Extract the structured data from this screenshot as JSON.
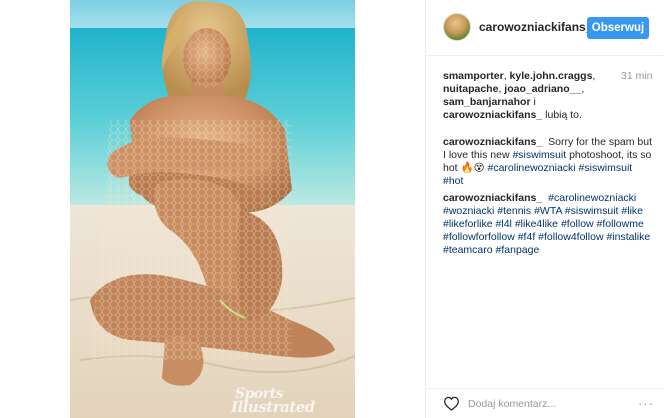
{
  "post": {
    "author": "carowozniackifans_",
    "follow_label": "Obserwuj",
    "time_ago": "31 min",
    "likes": {
      "users": [
        "smamporter",
        "kyle.john.craggs",
        "nuitapache",
        "joao_adriano__",
        "sam_banjarnahor"
      ],
      "and_label": "i",
      "last_user": "carowozniackifans_",
      "suffix": "lubią to."
    },
    "comments": [
      {
        "user": "carowozniackifans_",
        "text": "Sorry for the spam but I love this new",
        "tags_inline": [
          "#siswimsuit"
        ],
        "text2": "photoshoot, its so hot",
        "emoji": "🔥😵",
        "tags": [
          "#carolinewozniacki",
          "#siswimsuit",
          "#hot"
        ]
      },
      {
        "user": "carowozniackifans_",
        "tags": [
          "#carolinewozniacki",
          "#wozniacki",
          "#tennis",
          "#WTA",
          "#siswimsuit",
          "#like",
          "#likeforlike",
          "#l4l",
          "#like4like",
          "#follow",
          "#followme",
          "#followforfollow",
          "#f4f",
          "#follow4follow",
          "#instalike",
          "#teamcaro",
          "#fanpage"
        ]
      }
    ],
    "comment_placeholder": "Dodaj komentarz...",
    "more_label": "···",
    "watermark": {
      "line1": "Sports",
      "line2": "Illustrated"
    }
  },
  "colors": {
    "accent": "#3897f0",
    "hashtag": "#003569",
    "muted": "#999999"
  },
  "icons": {
    "like": "heart-icon",
    "options": "more-options-icon"
  }
}
